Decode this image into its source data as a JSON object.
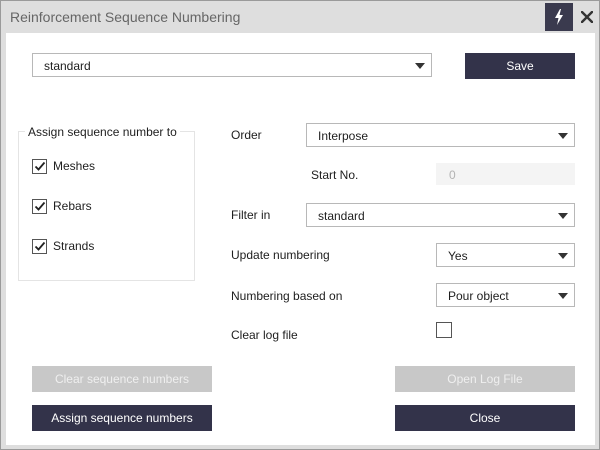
{
  "window": {
    "title": "Reinforcement Sequence Numbering"
  },
  "icons": {
    "pin": "lightning-icon",
    "close": "close-icon"
  },
  "settings": {
    "selected": "standard"
  },
  "buttons": {
    "save": "Save",
    "clear_sequence": "Clear sequence numbers",
    "open_log": "Open Log File",
    "assign_sequence": "Assign sequence numbers",
    "close": "Close"
  },
  "assign_group": {
    "title": "Assign sequence number to",
    "items": [
      {
        "label": "Meshes",
        "checked": true
      },
      {
        "label": "Rebars",
        "checked": true
      },
      {
        "label": "Strands",
        "checked": true
      }
    ]
  },
  "form": {
    "order": {
      "label": "Order",
      "value": "Interpose"
    },
    "start_no": {
      "label": "Start No.",
      "value": "0"
    },
    "filter_in": {
      "label": "Filter in",
      "value": "standard"
    },
    "update_numbering": {
      "label": "Update numbering",
      "value": "Yes"
    },
    "numbering_based_on": {
      "label": "Numbering based on",
      "value": "Pour object"
    },
    "clear_log": {
      "label": "Clear log file",
      "checked": false
    }
  },
  "colors": {
    "accent": "#33334a",
    "disabled": "#c8c8c8",
    "frame": "#dedede"
  }
}
